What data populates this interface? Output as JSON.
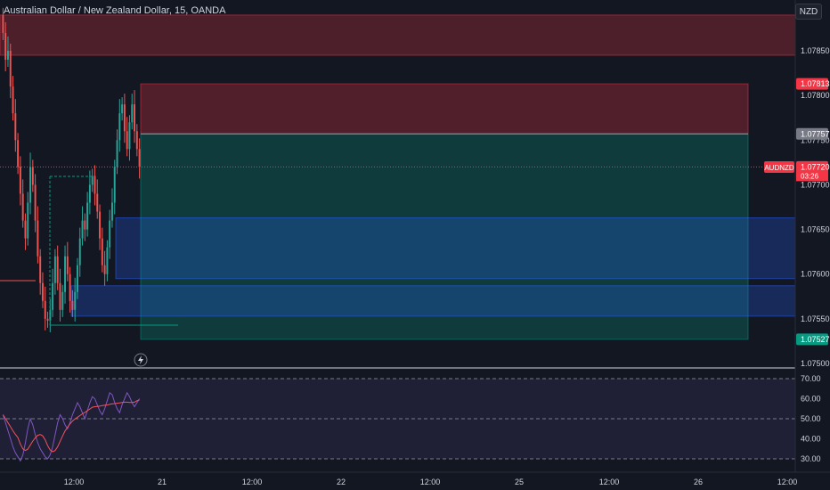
{
  "chart": {
    "title": "Australian Dollar / New Zealand Dollar, 15, OANDA",
    "currency": "NZD",
    "symbol": "AUDNZD",
    "countdown": "03:26"
  },
  "colors": {
    "background": "#131722",
    "up": "#26a69a",
    "down": "#ef5350",
    "rsi": "#7e57c2",
    "rsi_ma": "#f7525f",
    "price_line": "#f23645"
  },
  "chart_data": {
    "type": "line",
    "price_axis": {
      "ticks": [
        "1.07850",
        "1.07800",
        "1.07750",
        "1.07700",
        "1.07650",
        "1.07600",
        "1.07550",
        "1.07500"
      ],
      "tick_values": [
        1.0785,
        1.078,
        1.0775,
        1.077,
        1.0765,
        1.076,
        1.0755,
        1.075
      ],
      "range": [
        1.07495,
        1.0788
      ]
    },
    "price_labels": [
      {
        "value": 1.07813,
        "text": "1.07813",
        "color": "#f23645"
      },
      {
        "value": 1.07757,
        "text": "1.07757",
        "color": "#787b86"
      },
      {
        "value": 1.0772,
        "text": "1.07720",
        "color": "#f23645"
      },
      {
        "value": 1.07527,
        "text": "1.07527",
        "color": "#089981"
      }
    ],
    "time_axis": {
      "ticks": [
        "12:00",
        "21",
        "12:00",
        "22",
        "12:00",
        "25",
        "12:00",
        "26",
        "12:00"
      ]
    },
    "zones": [
      {
        "kind": "stop",
        "top": 1.07813,
        "bottom": 1.07757
      },
      {
        "kind": "target",
        "top": 1.07757,
        "bottom": 1.07527
      },
      {
        "kind": "supply",
        "top": 1.0789,
        "bottom": 1.07845
      },
      {
        "kind": "demand",
        "top": 1.07663,
        "bottom": 1.07595
      },
      {
        "kind": "demand",
        "top": 1.07587,
        "bottom": 1.07553
      }
    ],
    "price_path": [
      1.0787,
      1.0784,
      1.0785,
      1.0781,
      1.0778,
      1.0775,
      1.0772,
      1.0769,
      1.0766,
      1.0764,
      1.0768,
      1.0772,
      1.077,
      1.0766,
      1.0762,
      1.0759,
      1.0757,
      1.0755,
      1.07548,
      1.0756,
      1.0759,
      1.0762,
      1.0759,
      1.0756,
      1.0758,
      1.0762,
      1.076,
      1.0757,
      1.0756,
      1.0758,
      1.0761,
      1.0764,
      1.0766,
      1.0765,
      1.0768,
      1.077,
      1.0771,
      1.0769,
      1.0767,
      1.0764,
      1.0761,
      1.076,
      1.0763,
      1.0766,
      1.0768,
      1.0772,
      1.0775,
      1.0778,
      1.0779,
      1.0776,
      1.0774,
      1.0777,
      1.0779,
      1.0776,
      1.0774,
      1.0772
    ],
    "rsi": {
      "ticks": [
        "70.00",
        "60.00",
        "50.00",
        "40.00",
        "30.00"
      ],
      "tick_values": [
        70,
        60,
        50,
        40,
        30
      ],
      "range": [
        25,
        75
      ],
      "values": [
        52,
        48,
        44,
        40,
        36,
        33,
        31,
        29,
        32,
        38,
        45,
        50,
        47,
        42,
        38,
        35,
        33,
        31,
        30,
        32,
        36,
        42,
        48,
        52,
        50,
        47,
        45,
        48,
        52,
        55,
        58,
        56,
        53,
        50,
        54,
        58,
        61,
        60,
        57,
        54,
        52,
        55,
        59,
        63,
        62,
        58,
        55,
        53,
        57,
        60,
        63,
        61,
        58,
        56,
        58,
        60
      ]
    }
  }
}
